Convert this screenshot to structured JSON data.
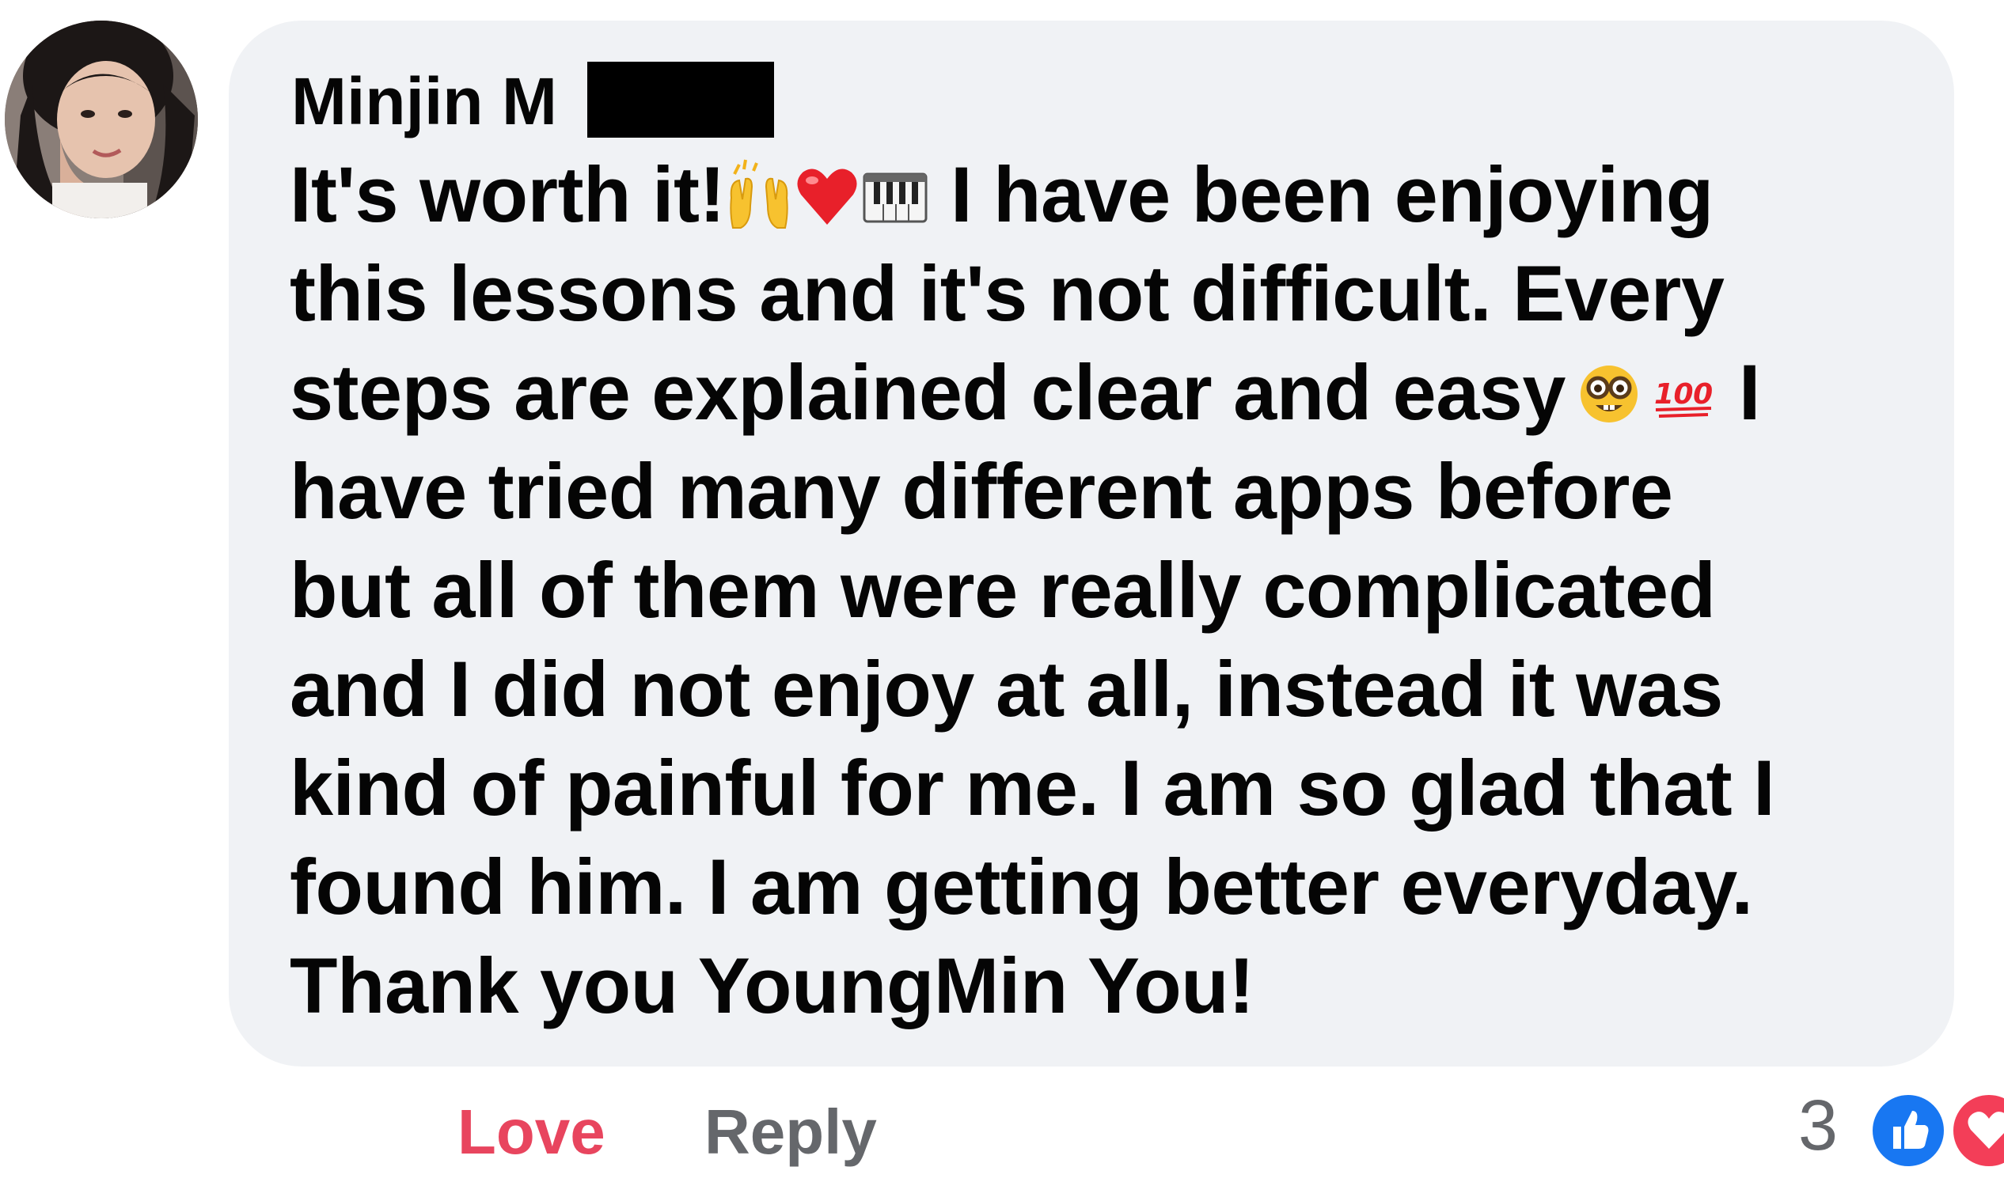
{
  "comment": {
    "author": "Minjin M",
    "text_lines": [
      [
        "It's worth it!",
        "raising-hands-icon",
        "red-heart-icon",
        "piano-keys-icon",
        " I have been enjoying"
      ],
      [
        "this lessons and it's not difficult. Every"
      ],
      [
        "steps are explained clear and easy",
        "nerd-face-icon",
        "hundred-points-icon",
        " I"
      ],
      [
        "have tried many different apps before"
      ],
      [
        "but all of them were really complicated"
      ],
      [
        "and I did not enjoy at all, instead it was"
      ],
      [
        "kind of painful for me. I am so glad that I"
      ],
      [
        "found him. I am getting better everyday."
      ],
      [
        "Thank you YoungMin You!"
      ]
    ]
  },
  "actions": {
    "love_label": "Love",
    "reply_label": "Reply"
  },
  "reactions": {
    "count": "3",
    "icons": [
      "like-icon",
      "love-icon"
    ]
  },
  "colors": {
    "bubble": "#f0f2f5",
    "love": "#e8455e",
    "muted": "#65676b",
    "like_blue": "#1877f2",
    "love_red": "#f33e58"
  }
}
